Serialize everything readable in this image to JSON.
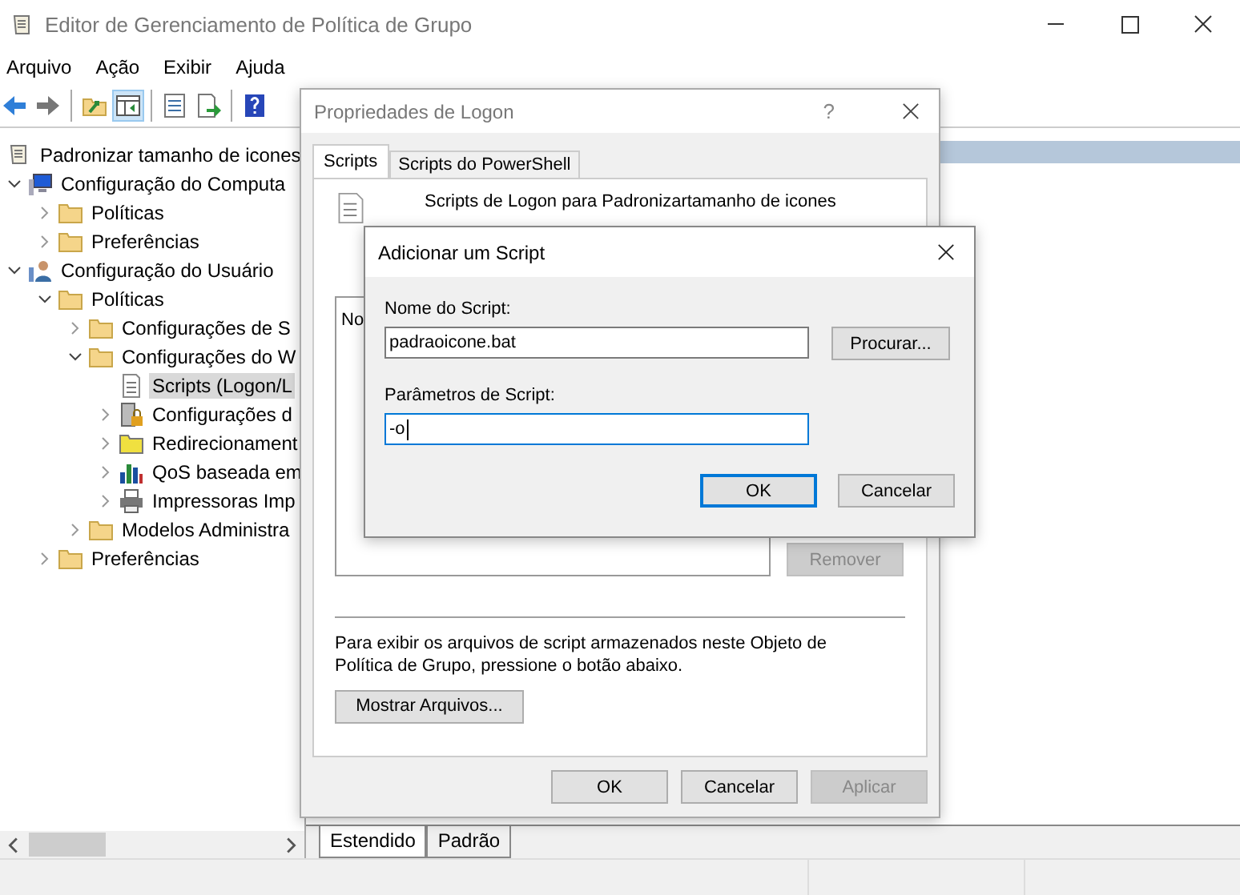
{
  "window": {
    "title": "Editor de Gerenciamento de Política de Grupo"
  },
  "menu": [
    "Arquivo",
    "Ação",
    "Exibir",
    "Ajuda"
  ],
  "tree": {
    "label": "Padronizar tamanho de icones",
    "kind": "scroll",
    "children": [
      {
        "label": "Configuração do Computa",
        "kind": "computer",
        "expanded": true,
        "selected": false,
        "children": [
          {
            "label": "Políticas",
            "kind": "folder",
            "expanded": false,
            "selected": false
          },
          {
            "label": "Preferências",
            "kind": "folder",
            "expanded": false,
            "selected": false
          }
        ]
      },
      {
        "label": "Configuração do Usuário",
        "kind": "user",
        "expanded": true,
        "selected": false,
        "children": [
          {
            "label": "Políticas",
            "kind": "folder",
            "expanded": true,
            "selected": false,
            "children": [
              {
                "label": "Configurações de S",
                "kind": "folder",
                "expanded": false,
                "selected": false
              },
              {
                "label": "Configurações do W",
                "kind": "folder",
                "expanded": true,
                "selected": false,
                "children": [
                  {
                    "label": "Scripts (Logon/L",
                    "kind": "script",
                    "selected": true
                  },
                  {
                    "label": "Configurações d",
                    "kind": "lock",
                    "expanded": false,
                    "selected": false
                  },
                  {
                    "label": "Redirecionament",
                    "kind": "redirect",
                    "expanded": false,
                    "selected": false
                  },
                  {
                    "label": "QoS baseada em",
                    "kind": "chart",
                    "expanded": false,
                    "selected": false
                  },
                  {
                    "label": "Impressoras Imp",
                    "kind": "printer",
                    "expanded": false,
                    "selected": false
                  }
                ]
              },
              {
                "label": "Modelos Administra",
                "kind": "folder",
                "expanded": false,
                "selected": false
              }
            ]
          },
          {
            "label": "Preferências",
            "kind": "folder",
            "expanded": false,
            "selected": false
          }
        ]
      }
    ]
  },
  "view_tabs": [
    {
      "label": "Estendido",
      "selected": true
    },
    {
      "label": "Padrão",
      "selected": false
    }
  ],
  "properties_dialog": {
    "title": "Propriedades de Logon",
    "help": "?",
    "tabs": [
      {
        "label": "Scripts",
        "selected": true
      },
      {
        "label": "Scripts do PowerShell",
        "selected": false
      }
    ],
    "heading": "Scripts de Logon para Padronizartamanho de icones",
    "list_header": "No",
    "remove_button": {
      "label": "Remover",
      "disabled": true
    },
    "note": "Para exibir os arquivos de script armazenados neste Objeto de Política de Grupo, pressione o botão abaixo.",
    "show_files_button": "Mostrar Arquivos...",
    "buttons": [
      {
        "label": "OK",
        "disabled": false
      },
      {
        "label": "Cancelar",
        "disabled": false
      },
      {
        "label": "Aplicar",
        "disabled": true
      }
    ]
  },
  "add_script_dialog": {
    "title": "Adicionar um Script",
    "fields": [
      {
        "label": "Nome do Script:",
        "value": "padraoicone.bat",
        "focused": false
      },
      {
        "label": "Parâmetros de Script:",
        "value": "-o",
        "focused": true
      }
    ],
    "browse_button": "Procurar...",
    "buttons": [
      {
        "label": "OK",
        "default": true
      },
      {
        "label": "Cancelar",
        "default": false
      }
    ]
  }
}
